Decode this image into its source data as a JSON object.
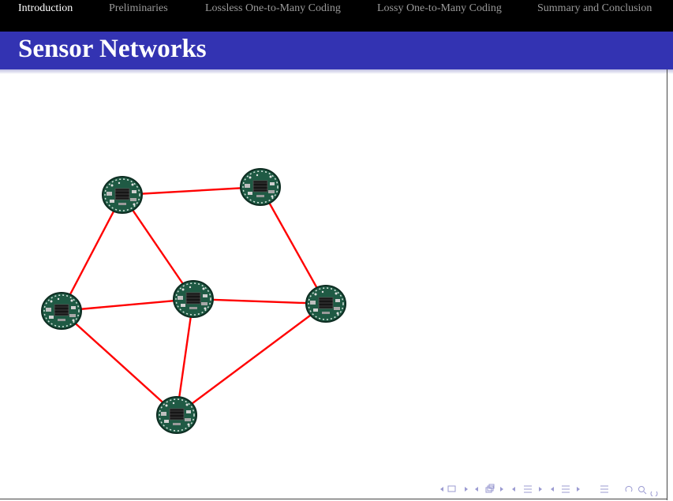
{
  "navbar": {
    "items": [
      {
        "label": "Introduction",
        "active": true
      },
      {
        "label": "Preliminaries",
        "active": false
      },
      {
        "label": "Lossless One-to-Many Coding",
        "active": false
      },
      {
        "label": "Lossy One-to-Many Coding",
        "active": false
      },
      {
        "label": "Summary and Conclusion",
        "active": false
      }
    ]
  },
  "slide": {
    "title": "Sensor Networks"
  },
  "network": {
    "nodes": [
      "sensor-a",
      "sensor-b",
      "sensor-c",
      "sensor-d",
      "sensor-e",
      "sensor-f"
    ],
    "link_color": "#ff0000",
    "node_icon": "sensor-board-icon"
  },
  "colors": {
    "navbar_bg": "#000000",
    "title_bg": "#3333b2",
    "nav_active": "#ffffff",
    "nav_inactive": "#9a9a9a",
    "nav_controls": "#9b9bd2"
  },
  "bottom_nav_icons": [
    "nav-left-icon",
    "frame-icon",
    "nav-right-icon",
    "subsection-icon",
    "section-icon",
    "appendix-icon",
    "search-icon"
  ]
}
